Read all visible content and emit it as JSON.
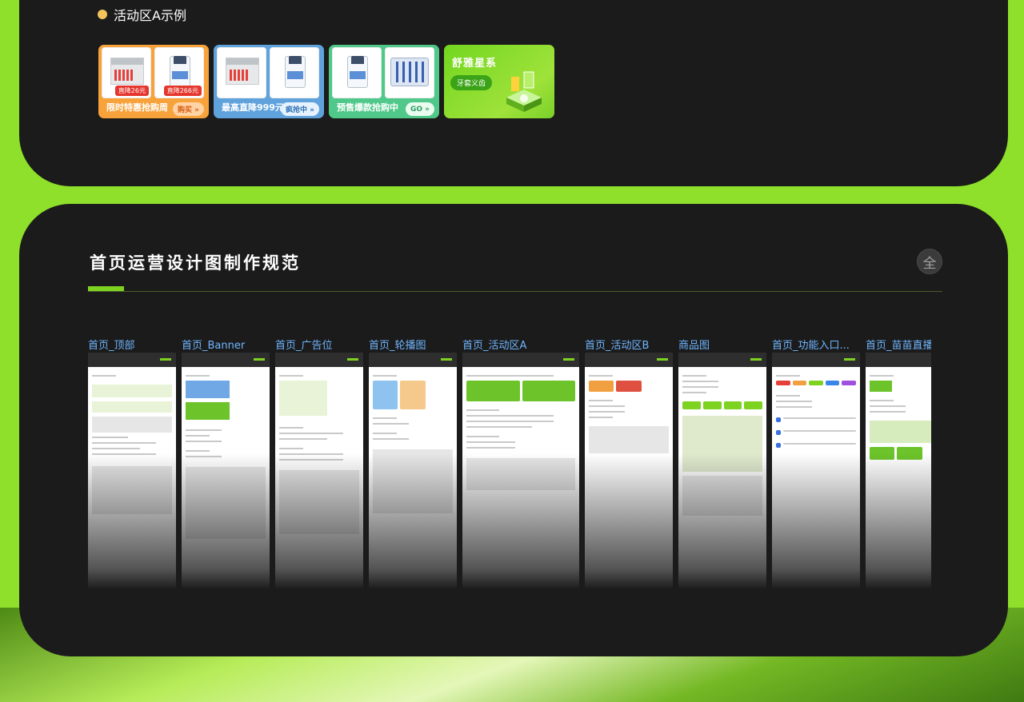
{
  "activity_section": {
    "title": "活动区A示例",
    "cards": [
      {
        "label": "限时特惠抢购周",
        "button": "购买 »",
        "prices": [
          "直降26元",
          "直降266元"
        ]
      },
      {
        "label": "最高直降999元",
        "button": "疯抢中 »"
      },
      {
        "label": "预售爆款抢购中",
        "button": "GO »"
      },
      {
        "title": "舒雅星系",
        "button": "牙套义齿"
      }
    ]
  },
  "spec_section": {
    "title": "首页运营设计图制作规范",
    "badge": "全",
    "thumbnails": [
      {
        "label": "首页_顶部"
      },
      {
        "label": "首页_Banner"
      },
      {
        "label": "首页_广告位"
      },
      {
        "label": "首页_轮播图"
      },
      {
        "label": "首页_活动区A"
      },
      {
        "label": "首页_活动区B"
      },
      {
        "label": "商品图"
      },
      {
        "label": "首页_功能入口..."
      },
      {
        "label": "首页_苗苗直播"
      }
    ]
  },
  "colors": {
    "accent": "#7ed321",
    "panel": "#1b1b1b",
    "background": "#8ee02a",
    "link": "#6fb6ff"
  }
}
